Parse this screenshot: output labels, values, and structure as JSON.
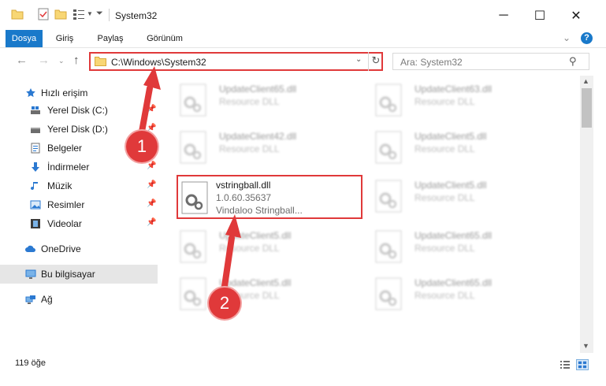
{
  "window": {
    "title": "System32",
    "minimize_glyph": "─",
    "maximize_glyph": "☐",
    "close_glyph": "✕"
  },
  "ribbon": {
    "tabs": [
      {
        "label": "Dosya",
        "active": true
      },
      {
        "label": "Giriş",
        "active": false
      },
      {
        "label": "Paylaş",
        "active": false
      },
      {
        "label": "Görünüm",
        "active": false
      }
    ],
    "help_glyph": "?"
  },
  "address": {
    "path": "C:\\Windows\\System32",
    "search_placeholder": "Ara: System32"
  },
  "nav": {
    "quick_access": "Hızlı erişim",
    "items": [
      {
        "label": "Yerel Disk (C:)",
        "icon": "drive-icon",
        "pinned": true
      },
      {
        "label": "Yerel Disk (D:)",
        "icon": "drive-icon",
        "pinned": true
      },
      {
        "label": "Belgeler",
        "icon": "documents-icon",
        "pinned": true
      },
      {
        "label": "İndirmeler",
        "icon": "download-icon",
        "pinned": true
      },
      {
        "label": "Müzik",
        "icon": "music-icon",
        "pinned": true
      },
      {
        "label": "Resimler",
        "icon": "pictures-icon",
        "pinned": true
      },
      {
        "label": "Videolar",
        "icon": "videos-icon",
        "pinned": true
      }
    ],
    "onedrive": "OneDrive",
    "this_pc": "Bu bilgisayar",
    "network": "Ağ"
  },
  "files": {
    "left": [
      {
        "name": "UpdateClient65.dll",
        "type": "Resource DLL"
      },
      {
        "name": "UpdateClient42.dll",
        "type": "Resource DLL"
      },
      {
        "name": "vstringball.dll",
        "version": "1.0.60.35637",
        "desc": "Vindaloo Stringball..."
      },
      {
        "name": "UpdateClient5.dll",
        "type": "Resource DLL"
      },
      {
        "name": "UpdateClient5.dll",
        "type": "Resource DLL"
      }
    ],
    "right": [
      {
        "name": "UpdateClient63.dll",
        "type": "Resource DLL"
      },
      {
        "name": "UpdateClient5.dll",
        "type": "Resource DLL"
      },
      {
        "name": "UpdateClient5.dll",
        "type": "Resource DLL"
      },
      {
        "name": "UpdateClient65.dll",
        "type": "Resource DLL"
      },
      {
        "name": "UpdateClient65.dll",
        "type": "Resource DLL"
      }
    ]
  },
  "status": {
    "count": "119 öğe"
  },
  "annotations": {
    "step1": "1",
    "step2": "2",
    "color": "#e0393a"
  },
  "colors": {
    "accent": "#1979ca",
    "highlight": "#e0393a"
  }
}
